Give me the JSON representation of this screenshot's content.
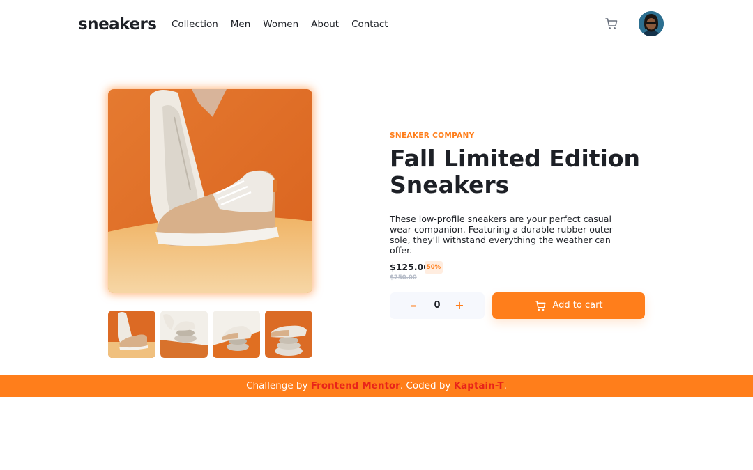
{
  "header": {
    "logo": "sneakers",
    "nav": [
      "Collection",
      "Men",
      "Women",
      "About",
      "Contact"
    ]
  },
  "gallery": {
    "thumbnail_count": 4
  },
  "product": {
    "company": "SNEAKER COMPANY",
    "title": "Fall Limited Edition Sneakers",
    "description": "These low-profile sneakers are your perfect casual wear companion. Featuring a durable rubber outer sole, they'll withstand everything the weather can offer.",
    "price": "$125.00",
    "discount": "50%",
    "original_price": "$250.00",
    "quantity": "0",
    "minus_symbol": "–",
    "plus_symbol": "+",
    "add_to_cart": "Add to cart"
  },
  "footer": {
    "challenge_by": "Challenge by",
    "frontend_mentor": "Frontend Mentor",
    "coded_by": ". Coded by",
    "author": "Kaptain-T",
    "end": "."
  },
  "colors": {
    "accent": "#ff7e1b",
    "dark": "#1d2026",
    "footer_link": "#e8231a"
  },
  "icons": {
    "cart": "cart-icon",
    "avatar": "avatar"
  }
}
